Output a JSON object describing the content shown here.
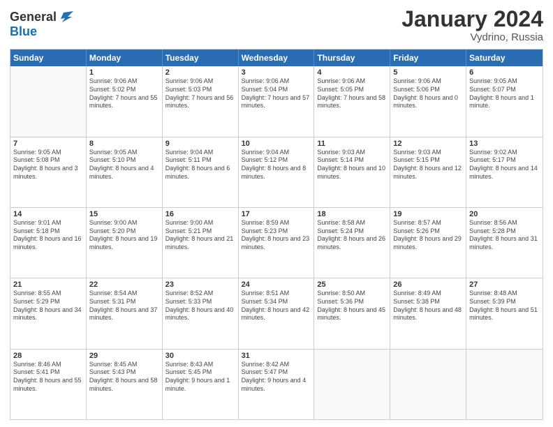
{
  "header": {
    "logo_line1": "General",
    "logo_line2": "Blue",
    "month": "January 2024",
    "location": "Vydrino, Russia"
  },
  "weekdays": [
    "Sunday",
    "Monday",
    "Tuesday",
    "Wednesday",
    "Thursday",
    "Friday",
    "Saturday"
  ],
  "rows": [
    [
      {
        "day": "",
        "sunrise": "",
        "sunset": "",
        "daylight": ""
      },
      {
        "day": "1",
        "sunrise": "Sunrise: 9:06 AM",
        "sunset": "Sunset: 5:02 PM",
        "daylight": "Daylight: 7 hours and 55 minutes."
      },
      {
        "day": "2",
        "sunrise": "Sunrise: 9:06 AM",
        "sunset": "Sunset: 5:03 PM",
        "daylight": "Daylight: 7 hours and 56 minutes."
      },
      {
        "day": "3",
        "sunrise": "Sunrise: 9:06 AM",
        "sunset": "Sunset: 5:04 PM",
        "daylight": "Daylight: 7 hours and 57 minutes."
      },
      {
        "day": "4",
        "sunrise": "Sunrise: 9:06 AM",
        "sunset": "Sunset: 5:05 PM",
        "daylight": "Daylight: 7 hours and 58 minutes."
      },
      {
        "day": "5",
        "sunrise": "Sunrise: 9:06 AM",
        "sunset": "Sunset: 5:06 PM",
        "daylight": "Daylight: 8 hours and 0 minutes."
      },
      {
        "day": "6",
        "sunrise": "Sunrise: 9:05 AM",
        "sunset": "Sunset: 5:07 PM",
        "daylight": "Daylight: 8 hours and 1 minute."
      }
    ],
    [
      {
        "day": "7",
        "sunrise": "Sunrise: 9:05 AM",
        "sunset": "Sunset: 5:08 PM",
        "daylight": "Daylight: 8 hours and 3 minutes."
      },
      {
        "day": "8",
        "sunrise": "Sunrise: 9:05 AM",
        "sunset": "Sunset: 5:10 PM",
        "daylight": "Daylight: 8 hours and 4 minutes."
      },
      {
        "day": "9",
        "sunrise": "Sunrise: 9:04 AM",
        "sunset": "Sunset: 5:11 PM",
        "daylight": "Daylight: 8 hours and 6 minutes."
      },
      {
        "day": "10",
        "sunrise": "Sunrise: 9:04 AM",
        "sunset": "Sunset: 5:12 PM",
        "daylight": "Daylight: 8 hours and 8 minutes."
      },
      {
        "day": "11",
        "sunrise": "Sunrise: 9:03 AM",
        "sunset": "Sunset: 5:14 PM",
        "daylight": "Daylight: 8 hours and 10 minutes."
      },
      {
        "day": "12",
        "sunrise": "Sunrise: 9:03 AM",
        "sunset": "Sunset: 5:15 PM",
        "daylight": "Daylight: 8 hours and 12 minutes."
      },
      {
        "day": "13",
        "sunrise": "Sunrise: 9:02 AM",
        "sunset": "Sunset: 5:17 PM",
        "daylight": "Daylight: 8 hours and 14 minutes."
      }
    ],
    [
      {
        "day": "14",
        "sunrise": "Sunrise: 9:01 AM",
        "sunset": "Sunset: 5:18 PM",
        "daylight": "Daylight: 8 hours and 16 minutes."
      },
      {
        "day": "15",
        "sunrise": "Sunrise: 9:00 AM",
        "sunset": "Sunset: 5:20 PM",
        "daylight": "Daylight: 8 hours and 19 minutes."
      },
      {
        "day": "16",
        "sunrise": "Sunrise: 9:00 AM",
        "sunset": "Sunset: 5:21 PM",
        "daylight": "Daylight: 8 hours and 21 minutes."
      },
      {
        "day": "17",
        "sunrise": "Sunrise: 8:59 AM",
        "sunset": "Sunset: 5:23 PM",
        "daylight": "Daylight: 8 hours and 23 minutes."
      },
      {
        "day": "18",
        "sunrise": "Sunrise: 8:58 AM",
        "sunset": "Sunset: 5:24 PM",
        "daylight": "Daylight: 8 hours and 26 minutes."
      },
      {
        "day": "19",
        "sunrise": "Sunrise: 8:57 AM",
        "sunset": "Sunset: 5:26 PM",
        "daylight": "Daylight: 8 hours and 29 minutes."
      },
      {
        "day": "20",
        "sunrise": "Sunrise: 8:56 AM",
        "sunset": "Sunset: 5:28 PM",
        "daylight": "Daylight: 8 hours and 31 minutes."
      }
    ],
    [
      {
        "day": "21",
        "sunrise": "Sunrise: 8:55 AM",
        "sunset": "Sunset: 5:29 PM",
        "daylight": "Daylight: 8 hours and 34 minutes."
      },
      {
        "day": "22",
        "sunrise": "Sunrise: 8:54 AM",
        "sunset": "Sunset: 5:31 PM",
        "daylight": "Daylight: 8 hours and 37 minutes."
      },
      {
        "day": "23",
        "sunrise": "Sunrise: 8:52 AM",
        "sunset": "Sunset: 5:33 PM",
        "daylight": "Daylight: 8 hours and 40 minutes."
      },
      {
        "day": "24",
        "sunrise": "Sunrise: 8:51 AM",
        "sunset": "Sunset: 5:34 PM",
        "daylight": "Daylight: 8 hours and 42 minutes."
      },
      {
        "day": "25",
        "sunrise": "Sunrise: 8:50 AM",
        "sunset": "Sunset: 5:36 PM",
        "daylight": "Daylight: 8 hours and 45 minutes."
      },
      {
        "day": "26",
        "sunrise": "Sunrise: 8:49 AM",
        "sunset": "Sunset: 5:38 PM",
        "daylight": "Daylight: 8 hours and 48 minutes."
      },
      {
        "day": "27",
        "sunrise": "Sunrise: 8:48 AM",
        "sunset": "Sunset: 5:39 PM",
        "daylight": "Daylight: 8 hours and 51 minutes."
      }
    ],
    [
      {
        "day": "28",
        "sunrise": "Sunrise: 8:46 AM",
        "sunset": "Sunset: 5:41 PM",
        "daylight": "Daylight: 8 hours and 55 minutes."
      },
      {
        "day": "29",
        "sunrise": "Sunrise: 8:45 AM",
        "sunset": "Sunset: 5:43 PM",
        "daylight": "Daylight: 8 hours and 58 minutes."
      },
      {
        "day": "30",
        "sunrise": "Sunrise: 8:43 AM",
        "sunset": "Sunset: 5:45 PM",
        "daylight": "Daylight: 9 hours and 1 minute."
      },
      {
        "day": "31",
        "sunrise": "Sunrise: 8:42 AM",
        "sunset": "Sunset: 5:47 PM",
        "daylight": "Daylight: 9 hours and 4 minutes."
      },
      {
        "day": "",
        "sunrise": "",
        "sunset": "",
        "daylight": ""
      },
      {
        "day": "",
        "sunrise": "",
        "sunset": "",
        "daylight": ""
      },
      {
        "day": "",
        "sunrise": "",
        "sunset": "",
        "daylight": ""
      }
    ]
  ]
}
